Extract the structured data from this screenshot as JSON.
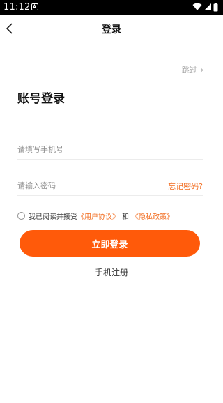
{
  "status_bar": {
    "time": "11:12",
    "icons": [
      "notification-a-icon",
      "wifi-icon",
      "signal-icon",
      "battery-icon"
    ]
  },
  "nav": {
    "back_icon": "chevron-left-icon",
    "title": "登录"
  },
  "skip": {
    "label": "跳过→"
  },
  "login_form": {
    "heading": "账号登录",
    "phone": {
      "placeholder": "请填写手机号",
      "value": ""
    },
    "password": {
      "placeholder": "请输入密码",
      "value": ""
    },
    "forgot_label": "忘记密码?",
    "agreement": {
      "checked": false,
      "prefix": "我已阅读并接受",
      "user_agreement": "《用户协议》",
      "and": "和",
      "privacy_policy": "《隐私政策》"
    },
    "submit_label": "立即登录",
    "register_label": "手机注册"
  },
  "colors": {
    "accent": "#ff5a0a",
    "link": "#f26b1d",
    "muted": "#a6a6a6",
    "status_bar": "#000000"
  }
}
